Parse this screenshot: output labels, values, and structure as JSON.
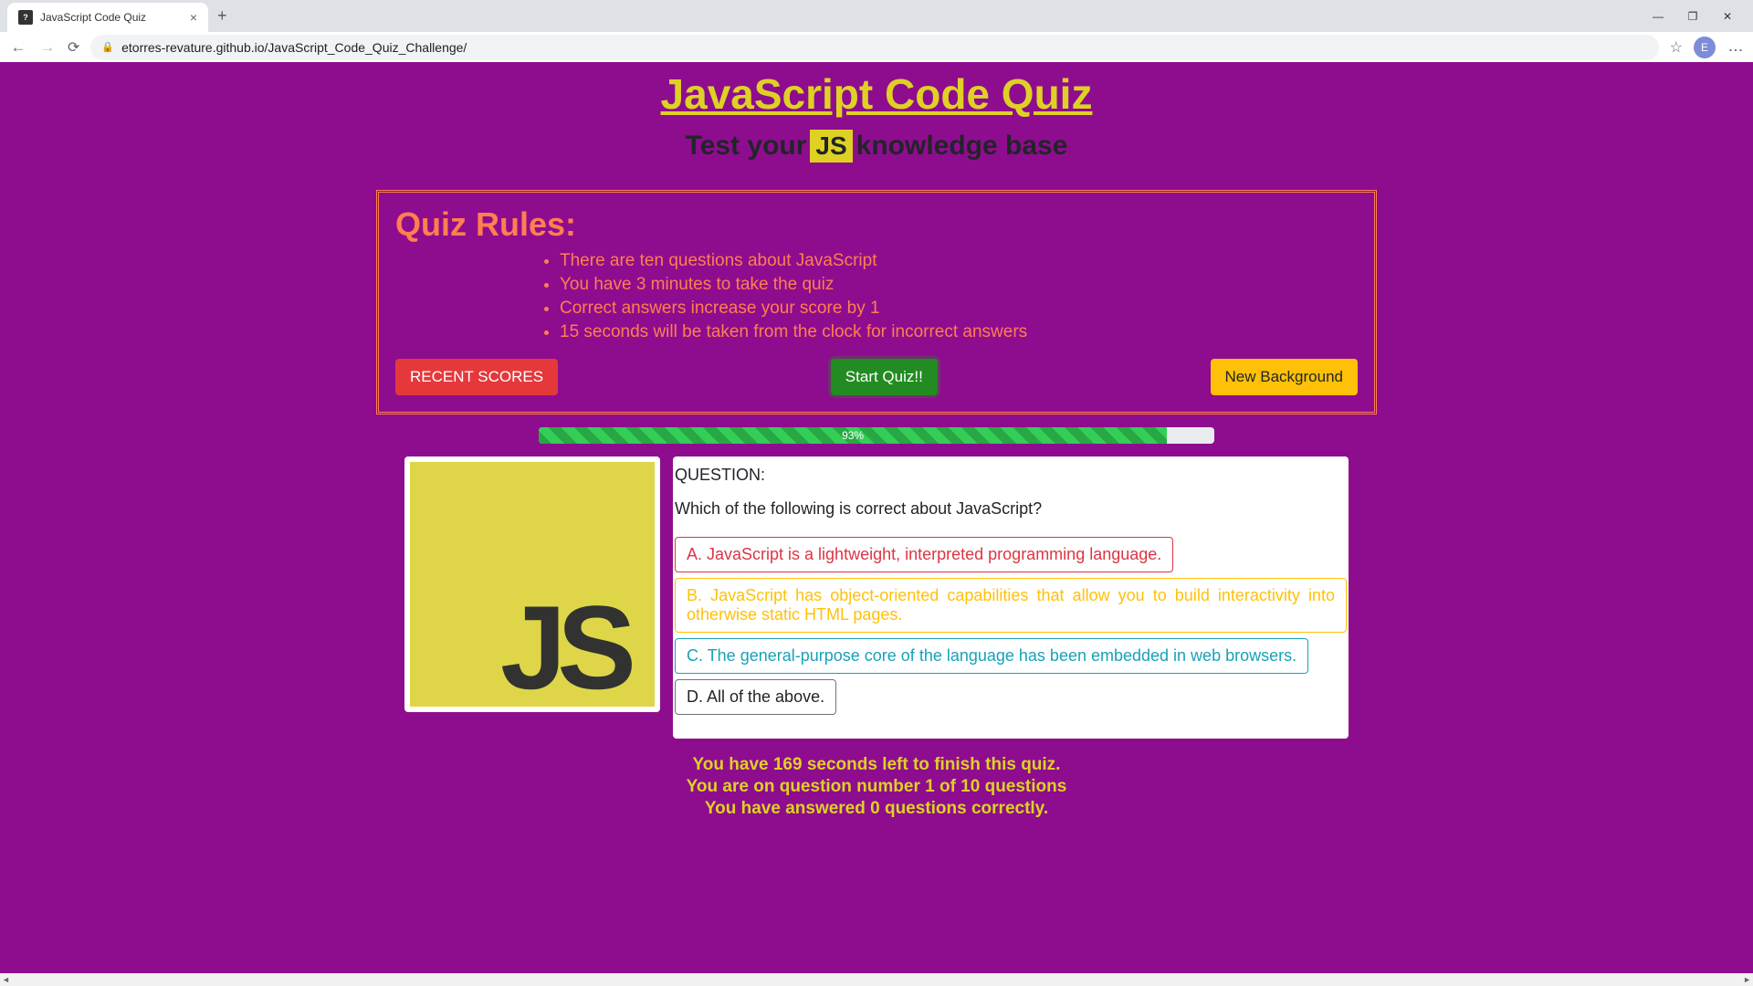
{
  "browser": {
    "tab_title": "JavaScript Code Quiz",
    "url": "etorres-revature.github.io/JavaScript_Code_Quiz_Challenge/",
    "profile_letter": "E"
  },
  "page": {
    "title": "JavaScript Code Quiz",
    "subtitle_prefix": "Test your",
    "subtitle_badge": "JS",
    "subtitle_suffix": "knowledge base"
  },
  "rules": {
    "heading": "Quiz Rules:",
    "items": [
      "There are ten questions about JavaScript",
      "You have 3 minutes to take the quiz",
      "Correct answers increase your score by 1",
      "15 seconds will be taken from the clock for incorrect answers"
    ]
  },
  "buttons": {
    "recent": "RECENT SCORES",
    "start": "Start Quiz!!",
    "background": "New Background"
  },
  "progress": {
    "percent": 93,
    "label": "93%"
  },
  "logo": {
    "text": "JS"
  },
  "question": {
    "label": "QUESTION:",
    "text": "Which of the following is correct about JavaScript?",
    "answers": {
      "a": "A. JavaScript is a lightweight, interpreted programming language.",
      "b": "B. JavaScript has object-oriented capabilities that allow you to build interactivity into otherwise static HTML pages.",
      "c": "C. The general-purpose core of the language has been embedded in web browsers.",
      "d": "D. All of the above."
    }
  },
  "status": {
    "time": "You have 169 seconds left to finish this quiz.",
    "question_num": "You are on question number 1 of 10 questions",
    "correct": "You have answered 0 questions correctly."
  }
}
